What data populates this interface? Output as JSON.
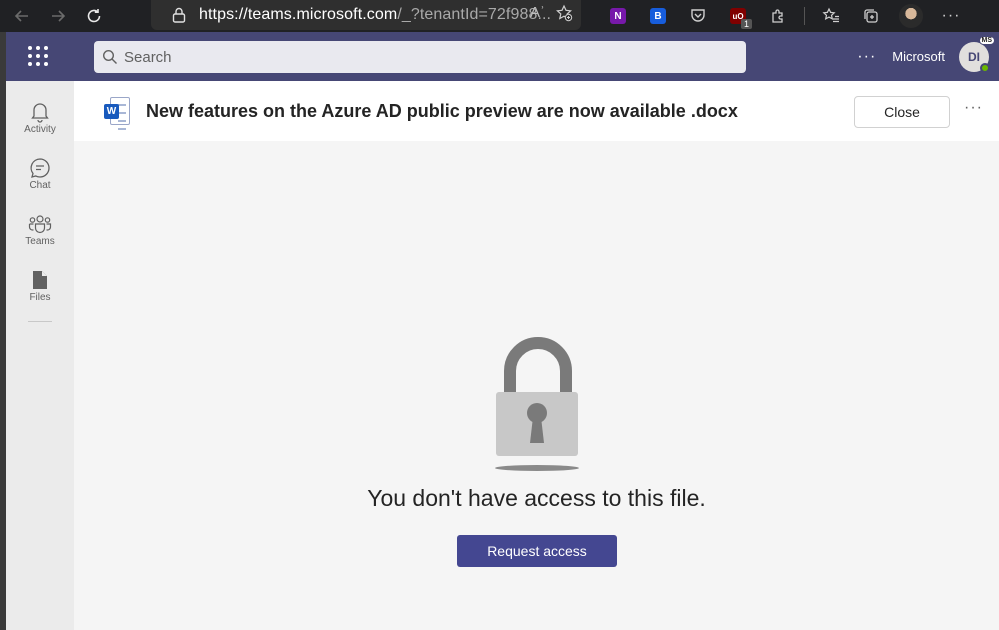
{
  "browser": {
    "url_host": "https://teams.microsoft.com",
    "url_rest": "/_?tenantId=72f988...",
    "read_aloud_label": "Aʾ",
    "extensions": [
      {
        "name": "onenote",
        "label": "N",
        "color": "#7719aa"
      },
      {
        "name": "bitwarden",
        "label": "B",
        "color": "#175ddc"
      },
      {
        "name": "pocket",
        "label": "",
        "color": ""
      },
      {
        "name": "ublock",
        "label": "uO",
        "color": "#800000",
        "badge": "1"
      }
    ]
  },
  "header": {
    "search_placeholder": "Search",
    "more": "···",
    "org": "Microsoft",
    "avatar_initials": "DI",
    "avatar_tag": "MS"
  },
  "rail": {
    "items": [
      {
        "label": "Activity",
        "icon": "bell-icon"
      },
      {
        "label": "Chat",
        "icon": "chat-icon"
      },
      {
        "label": "Teams",
        "icon": "teams-icon"
      },
      {
        "label": "Files",
        "icon": "file-icon"
      }
    ]
  },
  "file": {
    "title": "New features on the Azure AD public preview are now available .docx",
    "icon_letter": "W",
    "close_label": "Close",
    "more": "···"
  },
  "main": {
    "message": "You don't have access to this file.",
    "request_label": "Request access"
  },
  "colors": {
    "header": "#464775",
    "accent_button": "#444791",
    "rail": "#ebebeb",
    "content": "#f5f5f5"
  }
}
